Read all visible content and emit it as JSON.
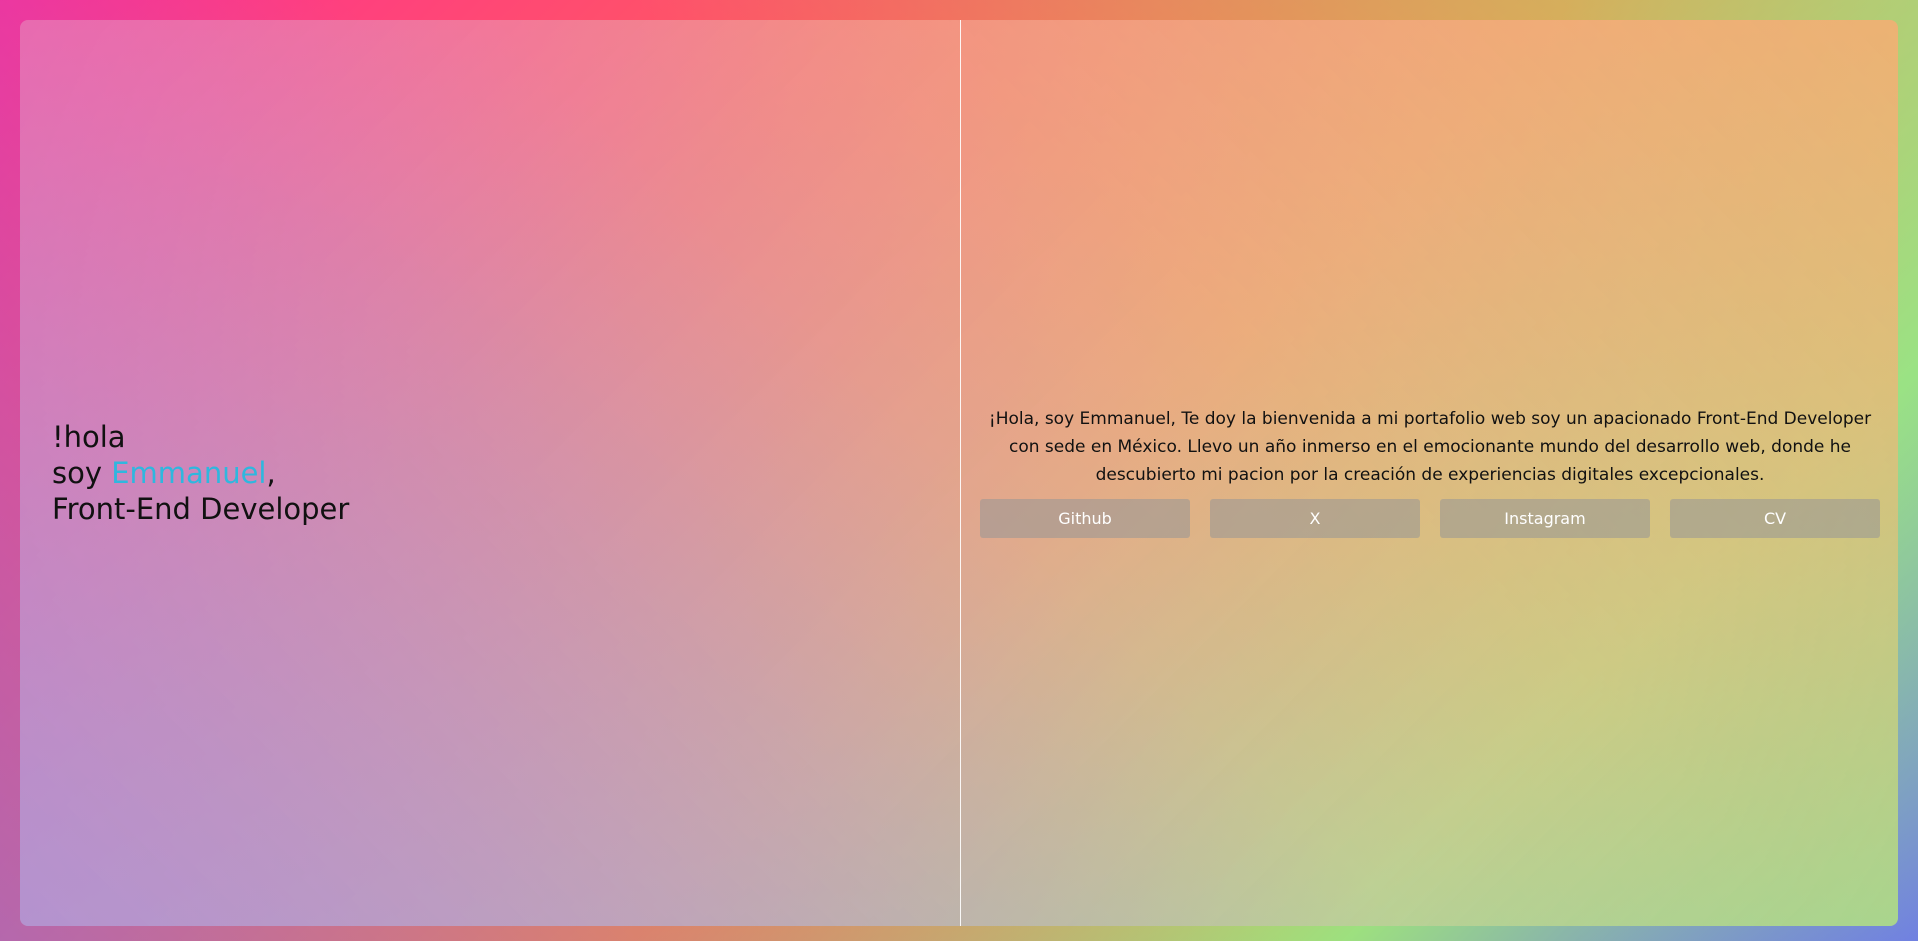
{
  "hero": {
    "line1": "!hola",
    "line2_prefix": "soy ",
    "name": "Emmanuel",
    "line2_suffix": ",",
    "line3": "Front-End Developer"
  },
  "intro": {
    "text": "¡Hola, soy Emmanuel, Te doy la bienvenida a mi portafolio web soy un apacionado Front-End Developer con sede en México. Llevo un año inmerso en el emocionante mundo del desarrollo web, donde he descubierto mi pacion por la creación de experiencias digitales excepcionales."
  },
  "buttons": [
    {
      "label": "Github"
    },
    {
      "label": "X"
    },
    {
      "label": "Instagram"
    },
    {
      "label": "CV"
    }
  ],
  "colors": {
    "accent_name": "#2fb7de",
    "button_bg": "rgba(150,150,150,0.55)"
  }
}
